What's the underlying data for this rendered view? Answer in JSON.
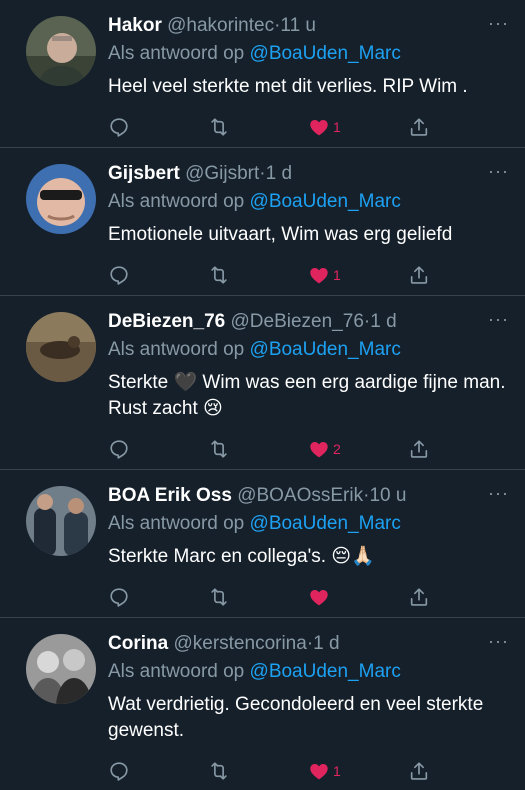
{
  "colors": {
    "background": "#15202b",
    "secondary_text": "#8899a6",
    "mention": "#1da1f2",
    "like": "#e0245e",
    "divider": "#38444d"
  },
  "tweets": [
    {
      "name": "Hakor",
      "handle": "@hakorintec",
      "dot": "·",
      "time": "11 u",
      "reply_prefix": "Als antwoord op",
      "reply_to": "@BoaUden_Marc",
      "text": "Heel veel sterkte met dit verlies.  RIP Wim .",
      "likes": "1",
      "more": "···"
    },
    {
      "name": "Gijsbert",
      "handle": "@Gijsbrt",
      "dot": "·",
      "time": "1 d",
      "reply_prefix": "Als antwoord op",
      "reply_to": "@BoaUden_Marc",
      "text": "Emotionele uitvaart, Wim was erg geliefd",
      "likes": "1",
      "more": "···"
    },
    {
      "name": "DeBiezen_76",
      "handle": "@DeBiezen_76",
      "dot": "·",
      "time": "1 d",
      "reply_prefix": "Als antwoord op",
      "reply_to": "@BoaUden_Marc",
      "text": "Sterkte 🖤  Wim was een erg aardige fijne man. Rust zacht 😢",
      "likes": "2",
      "more": "···"
    },
    {
      "name": "BOA Erik Oss",
      "handle": "@BOAOssErik",
      "dot": "·",
      "time": "10 u",
      "reply_prefix": "Als antwoord op",
      "reply_to": "@BoaUden_Marc",
      "text": "Sterkte Marc en collega's. 😔🙏🏻",
      "likes": "",
      "more": "···"
    },
    {
      "name": "Corina",
      "handle": "@kerstencorina",
      "dot": "·",
      "time": "1 d",
      "reply_prefix": "Als antwoord op",
      "reply_to": "@BoaUden_Marc",
      "text": "Wat verdrietig. Gecondoleerd en veel sterkte gewenst.",
      "likes": "1",
      "more": "···"
    }
  ],
  "icons": {
    "reply": "reply-icon",
    "retweet": "retweet-icon",
    "like": "heart-icon",
    "share": "share-icon",
    "more": "more-icon"
  }
}
